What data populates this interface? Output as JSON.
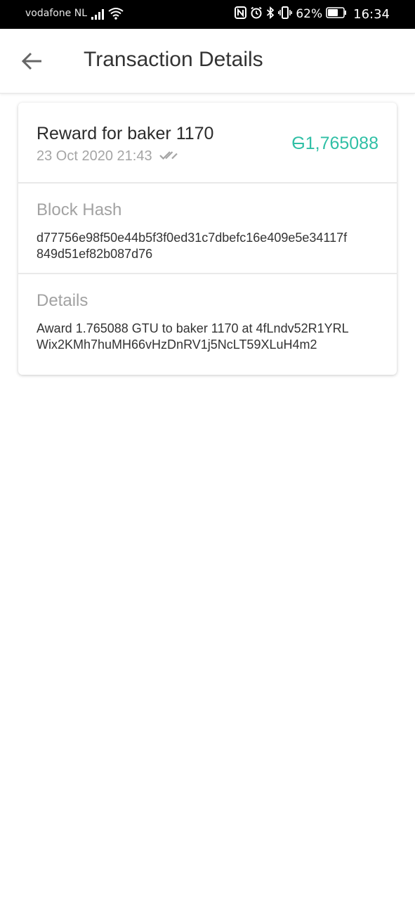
{
  "status_bar": {
    "carrier": "vodafone NL",
    "battery_percent": "62%",
    "time": "16:34",
    "icons": [
      "signal-icon",
      "wifi-icon",
      "nfc-icon",
      "alarm-icon",
      "bluetooth-icon",
      "vibrate-icon",
      "battery-icon"
    ]
  },
  "header": {
    "title": "Transaction Details",
    "back_icon": "arrow-left-icon"
  },
  "transaction": {
    "title": "Reward for baker 1170",
    "date": "23 Oct 2020 21:43",
    "status_icon": "double-check-icon",
    "currency_symbol": "G",
    "amount": "1,765088",
    "amount_color": "#2fbfa5"
  },
  "block_hash": {
    "label": "Block Hash",
    "line1": "d77756e98f50e44b5f3f0ed31c7dbefc16e409e5e34117f",
    "line2": "849d51ef82b087d76"
  },
  "details": {
    "label": "Details",
    "line1": "Award 1.765088 GTU to baker 1170 at 4fLndv52R1YRL",
    "line2": "Wix2KMh7huMH66vHzDnRV1j5NcLT59XLuH4m2"
  }
}
